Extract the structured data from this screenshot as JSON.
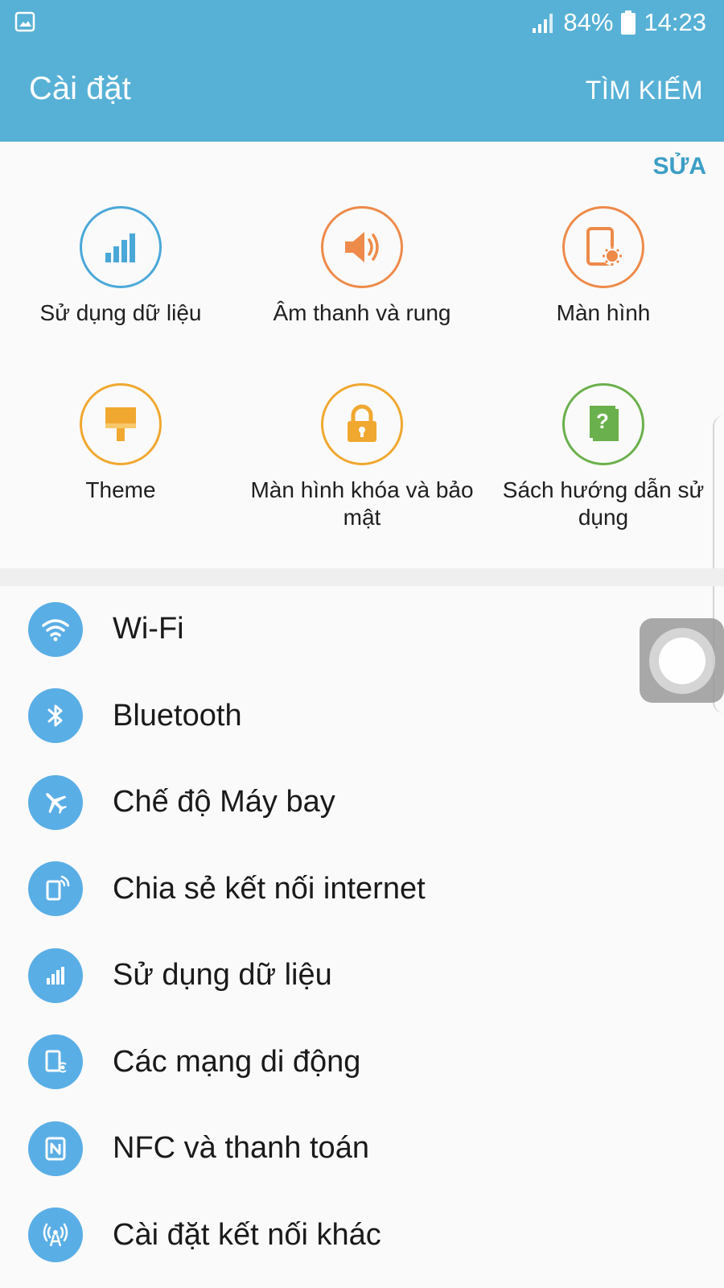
{
  "status": {
    "battery": "84%",
    "time": "14:23"
  },
  "header": {
    "title": "Cài đặt",
    "search_label": "TÌM KIẾM"
  },
  "quick": {
    "edit_label": "SỬA",
    "tiles": [
      {
        "label": "Sử dụng dữ liệu",
        "icon": "data-usage-icon",
        "color": "#4aa8d8"
      },
      {
        "label": "Âm thanh và rung",
        "icon": "sound-icon",
        "color": "#ee8a4a"
      },
      {
        "label": "Màn hình",
        "icon": "display-icon",
        "color": "#ee8a4a"
      },
      {
        "label": "Theme",
        "icon": "theme-brush-icon",
        "color": "#f0a830"
      },
      {
        "label": "Màn hình khóa và bảo mật",
        "icon": "lock-icon",
        "color": "#f0a830"
      },
      {
        "label": "Sách hướng dẫn sử dụng",
        "icon": "user-manual-icon",
        "color": "#6ab04c"
      }
    ]
  },
  "list": {
    "items": [
      {
        "label": "Wi-Fi",
        "icon": "wifi-icon"
      },
      {
        "label": "Bluetooth",
        "icon": "bluetooth-icon"
      },
      {
        "label": "Chế độ Máy bay",
        "icon": "airplane-icon"
      },
      {
        "label": "Chia sẻ kết nối internet",
        "icon": "hotspot-icon"
      },
      {
        "label": "Sử dụng dữ liệu",
        "icon": "data-usage-icon"
      },
      {
        "label": "Các mạng di động",
        "icon": "mobile-network-icon"
      },
      {
        "label": "NFC và thanh toán",
        "icon": "nfc-icon"
      },
      {
        "label": "Cài đặt kết nối khác",
        "icon": "more-connections-icon"
      }
    ]
  },
  "colors": {
    "appbar": "#57b1d6",
    "list_icon_bg": "#5aaee6",
    "edit_link": "#3c9ec6"
  }
}
